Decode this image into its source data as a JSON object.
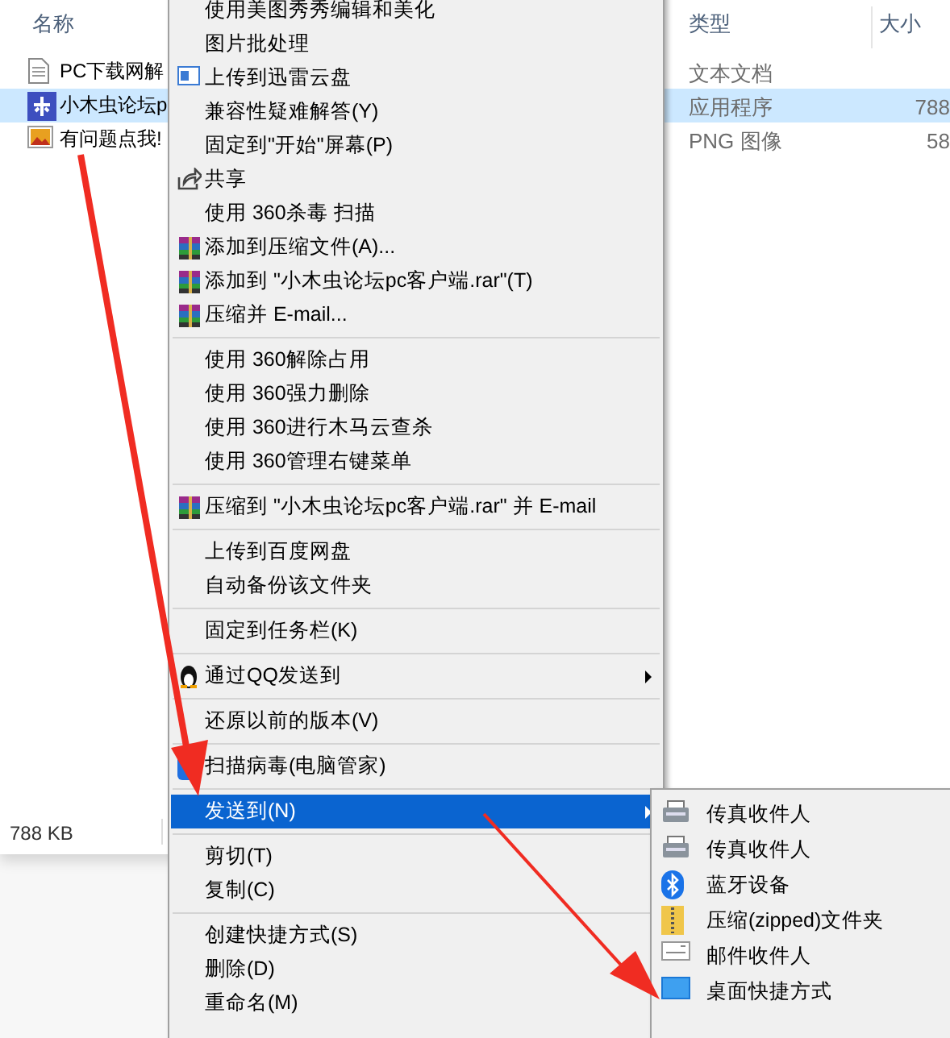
{
  "explorer": {
    "columns": [
      {
        "label": "名称"
      },
      {
        "label": "类型"
      },
      {
        "label": "大小"
      }
    ],
    "files": [
      {
        "name": "PC下载网解",
        "type": "文本文档",
        "selected": false
      },
      {
        "name": "小木虫论坛p",
        "type": "应用程序",
        "size": "788",
        "selected": true
      },
      {
        "name": "有问题点我!",
        "type": "PNG 图像",
        "size": "58",
        "selected": false
      }
    ],
    "status": "788 KB"
  },
  "context_menu": {
    "items": [
      {
        "kind": "item",
        "label": "使用美图秀秀编辑和美化",
        "has_submenu": false,
        "selected": false
      },
      {
        "kind": "item",
        "label": "图片批处理",
        "has_submenu": false,
        "selected": false
      },
      {
        "kind": "item",
        "label": "上传到迅雷云盘",
        "has_submenu": false,
        "selected": false
      },
      {
        "kind": "item",
        "label": "兼容性疑难解答(Y)",
        "has_submenu": false,
        "selected": false
      },
      {
        "kind": "item",
        "label": "固定到\"开始\"屏幕(P)",
        "has_submenu": false,
        "selected": false
      },
      {
        "kind": "item",
        "label": "共享",
        "has_submenu": false,
        "selected": false
      },
      {
        "kind": "item",
        "label": "使用 360杀毒 扫描",
        "has_submenu": false,
        "selected": false
      },
      {
        "kind": "item",
        "label": "添加到压缩文件(A)...",
        "has_submenu": false,
        "selected": false
      },
      {
        "kind": "item",
        "label": "添加到 \"小木虫论坛pc客户端.rar\"(T)",
        "has_submenu": false,
        "selected": false
      },
      {
        "kind": "item",
        "label": "压缩并 E-mail...",
        "has_submenu": false,
        "selected": false
      },
      {
        "kind": "separator"
      },
      {
        "kind": "item",
        "label": "使用 360解除占用",
        "has_submenu": false,
        "selected": false
      },
      {
        "kind": "item",
        "label": "使用 360强力删除",
        "has_submenu": false,
        "selected": false
      },
      {
        "kind": "item",
        "label": "使用 360进行木马云查杀",
        "has_submenu": false,
        "selected": false
      },
      {
        "kind": "item",
        "label": "使用 360管理右键菜单",
        "has_submenu": false,
        "selected": false
      },
      {
        "kind": "separator"
      },
      {
        "kind": "item",
        "label": "压缩到 \"小木虫论坛pc客户端.rar\" 并 E-mail",
        "has_submenu": false,
        "selected": false
      },
      {
        "kind": "separator"
      },
      {
        "kind": "item",
        "label": "上传到百度网盘",
        "has_submenu": false,
        "selected": false
      },
      {
        "kind": "item",
        "label": "自动备份该文件夹",
        "has_submenu": false,
        "selected": false
      },
      {
        "kind": "separator"
      },
      {
        "kind": "item",
        "label": "固定到任务栏(K)",
        "has_submenu": false,
        "selected": false
      },
      {
        "kind": "separator"
      },
      {
        "kind": "item",
        "label": "通过QQ发送到",
        "has_submenu": true,
        "selected": false
      },
      {
        "kind": "separator"
      },
      {
        "kind": "item",
        "label": "还原以前的版本(V)",
        "has_submenu": false,
        "selected": false
      },
      {
        "kind": "separator"
      },
      {
        "kind": "item",
        "label": "扫描病毒(电脑管家)",
        "has_submenu": false,
        "selected": false
      },
      {
        "kind": "separator"
      },
      {
        "kind": "item",
        "label": "发送到(N)",
        "has_submenu": true,
        "selected": true
      },
      {
        "kind": "separator"
      },
      {
        "kind": "item",
        "label": "剪切(T)",
        "has_submenu": false,
        "selected": false
      },
      {
        "kind": "item",
        "label": "复制(C)",
        "has_submenu": false,
        "selected": false
      },
      {
        "kind": "separator"
      },
      {
        "kind": "item",
        "label": "创建快捷方式(S)",
        "has_submenu": false,
        "selected": false
      },
      {
        "kind": "item",
        "label": "删除(D)",
        "has_submenu": false,
        "selected": false
      },
      {
        "kind": "item",
        "label": "重命名(M)",
        "has_submenu": false,
        "selected": false
      }
    ]
  },
  "send_to_menu": {
    "items": [
      {
        "label": "传真收件人"
      },
      {
        "label": "传真收件人"
      },
      {
        "label": "蓝牙设备"
      },
      {
        "label": "压缩(zipped)文件夹"
      },
      {
        "label": "邮件收件人"
      },
      {
        "label": "桌面快捷方式"
      }
    ]
  }
}
